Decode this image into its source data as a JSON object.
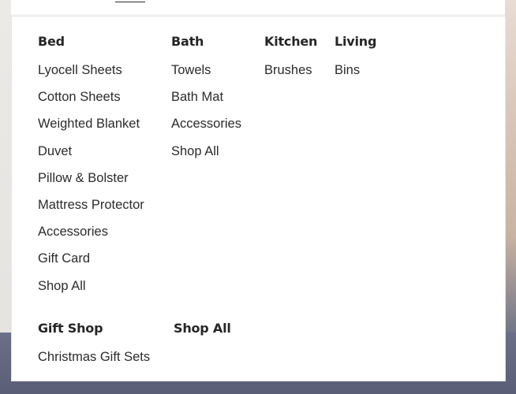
{
  "menu": {
    "columns": [
      {
        "heading": "Bed",
        "items": [
          "Lyocell Sheets",
          "Cotton Sheets",
          "Weighted Blanket",
          "Duvet",
          "Pillow & Bolster",
          "Mattress Protector",
          "Accessories",
          "Gift Card",
          "Shop All"
        ]
      },
      {
        "heading": "Bath",
        "items": [
          "Towels",
          "Bath Mat",
          "Accessories",
          "Shop All"
        ]
      },
      {
        "heading": "Kitchen",
        "items": [
          "Brushes"
        ]
      },
      {
        "heading": "Living",
        "items": [
          "Bins"
        ]
      }
    ],
    "gift_shop": {
      "heading": "Gift Shop",
      "items": [
        "Christmas Gift Sets"
      ]
    },
    "shop_all": {
      "heading": "Shop All"
    }
  }
}
